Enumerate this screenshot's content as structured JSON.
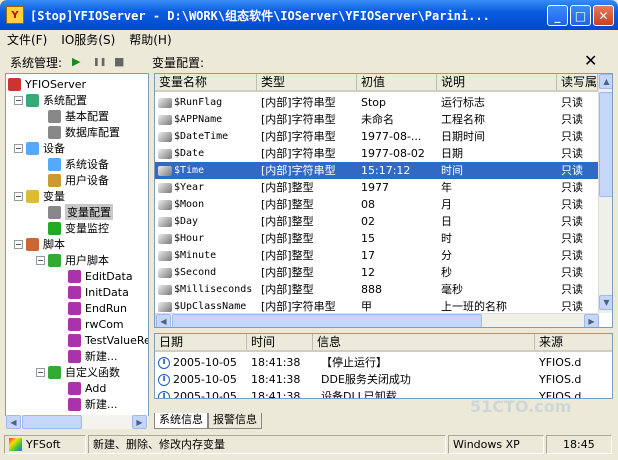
{
  "window": {
    "title": "[Stop]YFIOServer - D:\\WORK\\组态软件\\IOServer\\YFIOServer\\Parini..."
  },
  "menu": [
    "文件(F)",
    "IO服务(S)",
    "帮助(H)"
  ],
  "toolbar": {
    "sys_label": "系统管理:",
    "var_label": "变量配置:",
    "play": "▶",
    "pause": "❚❚",
    "stop": "■",
    "close": "✕"
  },
  "tree": [
    {
      "label": "YFIOServer",
      "icon": "server-icon"
    },
    {
      "label": "系统配置",
      "icon": "gear-icon"
    },
    {
      "label": "基本配置",
      "icon": "doc-icon"
    },
    {
      "label": "数据库配置",
      "icon": "db-icon"
    },
    {
      "label": "设备",
      "icon": "device-icon"
    },
    {
      "label": "系统设备",
      "icon": "sys-device-icon"
    },
    {
      "label": "用户设备",
      "icon": "user-device-icon"
    },
    {
      "label": "变量",
      "icon": "folder-icon"
    },
    {
      "label": "变量配置",
      "icon": "var-config-icon"
    },
    {
      "label": "变量监控",
      "icon": "monitor-icon"
    },
    {
      "label": "脚本",
      "icon": "script-icon"
    },
    {
      "label": "用户脚本",
      "icon": "check-icon"
    },
    {
      "label": "EditData",
      "icon": "script-file-icon"
    },
    {
      "label": "InitData",
      "icon": "script-file-icon"
    },
    {
      "label": "EndRun",
      "icon": "script-file-icon"
    },
    {
      "label": "rwCom",
      "icon": "script-file-icon"
    },
    {
      "label": "TestValueRe",
      "icon": "script-file-icon"
    },
    {
      "label": "新建...",
      "icon": "script-file-icon"
    },
    {
      "label": "自定义函数",
      "icon": "check-icon"
    },
    {
      "label": "Add",
      "icon": "script-file-icon"
    },
    {
      "label": "新建...",
      "icon": "script-file-icon"
    }
  ],
  "grid": {
    "columns": [
      "变量名称",
      "类型",
      "初值",
      "说明",
      "读写属"
    ],
    "rows": [
      [
        "$RunFlag",
        "[内部]字符串型",
        "Stop",
        "运行标志",
        "只读"
      ],
      [
        "$APPName",
        "[内部]字符串型",
        "未命名",
        "工程名称",
        "只读"
      ],
      [
        "$DateTime",
        "[内部]字符串型",
        "1977-08-...",
        "日期时间",
        "只读"
      ],
      [
        "$Date",
        "[内部]字符串型",
        "1977-08-02",
        "日期",
        "只读"
      ],
      [
        "$Time",
        "[内部]字符串型",
        "15:17:12",
        "时间",
        "只读"
      ],
      [
        "$Year",
        "[内部]整型",
        "1977",
        "年",
        "只读"
      ],
      [
        "$Moon",
        "[内部]整型",
        "08",
        "月",
        "只读"
      ],
      [
        "$Day",
        "[内部]整型",
        "02",
        "日",
        "只读"
      ],
      [
        "$Hour",
        "[内部]整型",
        "15",
        "时",
        "只读"
      ],
      [
        "$Minute",
        "[内部]整型",
        "17",
        "分",
        "只读"
      ],
      [
        "$Second",
        "[内部]整型",
        "12",
        "秒",
        "只读"
      ],
      [
        "$Milliseconds",
        "[内部]整型",
        "888",
        "毫秒",
        "只读"
      ],
      [
        "$UpClassName",
        "[内部]字符串型",
        "甲",
        "上一班的名称",
        "只读"
      ]
    ],
    "selected_index": 4
  },
  "log": {
    "columns": [
      "日期",
      "时间",
      "信息",
      "来源"
    ],
    "rows": [
      [
        "2005-10-05",
        "18:41:38",
        "【停止运行】",
        "YFIOS.d"
      ],
      [
        "2005-10-05",
        "18:41:38",
        "DDE服务关闭成功",
        "YFIOS.d"
      ],
      [
        "2005-10-05",
        "18:41:38",
        "设备DLL已卸载",
        "YFIOS.d"
      ]
    ]
  },
  "tabs": [
    "系统信息",
    "报警信息"
  ],
  "status": {
    "company": "YFSoft",
    "message": "新建、删除、修改内存变量",
    "os": "Windows XP",
    "time": "18:45"
  },
  "watermark": "51CTO.com"
}
